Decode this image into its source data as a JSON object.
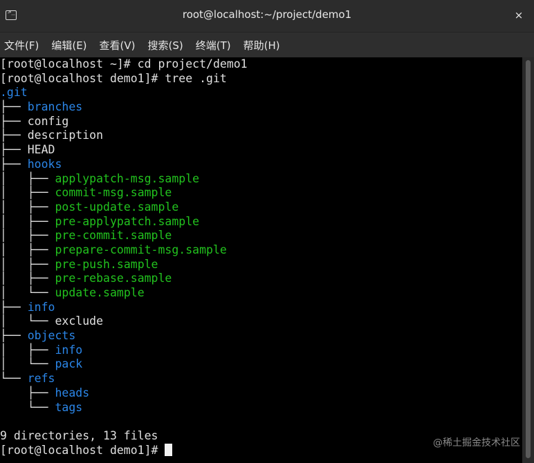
{
  "window": {
    "title": "root@localhost:~/project/demo1",
    "close_glyph": "×"
  },
  "menu": {
    "items": [
      "文件(F)",
      "编辑(E)",
      "查看(V)",
      "搜索(S)",
      "终端(T)",
      "帮助(H)"
    ]
  },
  "terminal": {
    "colors": {
      "background": "#000000",
      "text": "#e0e0e0",
      "directory": "#2b86e8",
      "executable": "#22c21e"
    },
    "lines": [
      [
        {
          "t": "[root@localhost ~]# cd project/demo1",
          "c": "plain"
        }
      ],
      [
        {
          "t": "[root@localhost demo1]# tree .git",
          "c": "plain"
        }
      ],
      [
        {
          "t": ".git",
          "c": "dir"
        }
      ],
      [
        {
          "t": "├── ",
          "c": "plain"
        },
        {
          "t": "branches",
          "c": "dir"
        }
      ],
      [
        {
          "t": "├── config",
          "c": "plain"
        }
      ],
      [
        {
          "t": "├── description",
          "c": "plain"
        }
      ],
      [
        {
          "t": "├── HEAD",
          "c": "plain"
        }
      ],
      [
        {
          "t": "├── ",
          "c": "plain"
        },
        {
          "t": "hooks",
          "c": "dir"
        }
      ],
      [
        {
          "t": "│   ├── ",
          "c": "plain"
        },
        {
          "t": "applypatch-msg.sample",
          "c": "exe"
        }
      ],
      [
        {
          "t": "│   ├── ",
          "c": "plain"
        },
        {
          "t": "commit-msg.sample",
          "c": "exe"
        }
      ],
      [
        {
          "t": "│   ├── ",
          "c": "plain"
        },
        {
          "t": "post-update.sample",
          "c": "exe"
        }
      ],
      [
        {
          "t": "│   ├── ",
          "c": "plain"
        },
        {
          "t": "pre-applypatch.sample",
          "c": "exe"
        }
      ],
      [
        {
          "t": "│   ├── ",
          "c": "plain"
        },
        {
          "t": "pre-commit.sample",
          "c": "exe"
        }
      ],
      [
        {
          "t": "│   ├── ",
          "c": "plain"
        },
        {
          "t": "prepare-commit-msg.sample",
          "c": "exe"
        }
      ],
      [
        {
          "t": "│   ├── ",
          "c": "plain"
        },
        {
          "t": "pre-push.sample",
          "c": "exe"
        }
      ],
      [
        {
          "t": "│   ├── ",
          "c": "plain"
        },
        {
          "t": "pre-rebase.sample",
          "c": "exe"
        }
      ],
      [
        {
          "t": "│   └── ",
          "c": "plain"
        },
        {
          "t": "update.sample",
          "c": "exe"
        }
      ],
      [
        {
          "t": "├── ",
          "c": "plain"
        },
        {
          "t": "info",
          "c": "dir"
        }
      ],
      [
        {
          "t": "│   └── exclude",
          "c": "plain"
        }
      ],
      [
        {
          "t": "├── ",
          "c": "plain"
        },
        {
          "t": "objects",
          "c": "dir"
        }
      ],
      [
        {
          "t": "│   ├── ",
          "c": "plain"
        },
        {
          "t": "info",
          "c": "dir"
        }
      ],
      [
        {
          "t": "│   └── ",
          "c": "plain"
        },
        {
          "t": "pack",
          "c": "dir"
        }
      ],
      [
        {
          "t": "└── ",
          "c": "plain"
        },
        {
          "t": "refs",
          "c": "dir"
        }
      ],
      [
        {
          "t": "    ├── ",
          "c": "plain"
        },
        {
          "t": "heads",
          "c": "dir"
        }
      ],
      [
        {
          "t": "    └── ",
          "c": "plain"
        },
        {
          "t": "tags",
          "c": "dir"
        }
      ],
      [
        {
          "t": "",
          "c": "plain"
        }
      ],
      [
        {
          "t": "9 directories, 13 files",
          "c": "plain"
        }
      ],
      [
        {
          "t": "[root@localhost demo1]# ",
          "c": "plain",
          "cursor": true
        }
      ]
    ]
  },
  "watermark": "@稀土掘金技术社区"
}
